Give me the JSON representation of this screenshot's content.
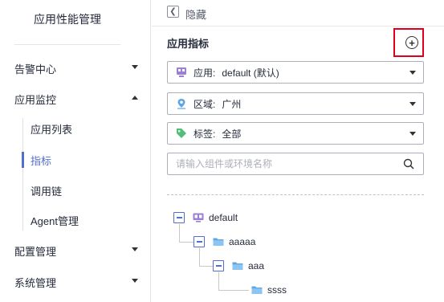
{
  "sidebar": {
    "app_title": "应用性能管理",
    "menu": [
      {
        "label": "告警中心"
      },
      {
        "label": "应用监控"
      },
      {
        "label": "配置管理"
      },
      {
        "label": "系统管理"
      }
    ],
    "sub_items": [
      {
        "label": "应用列表"
      },
      {
        "label": "指标"
      },
      {
        "label": "调用链"
      },
      {
        "label": "Agent管理"
      }
    ]
  },
  "topbar": {
    "hide_label": "隐藏"
  },
  "panel": {
    "title": "应用指标",
    "app_select": {
      "label": "应用:",
      "value": "default (默认)"
    },
    "region_select": {
      "label": "区域:",
      "value": "广州"
    },
    "tag_select": {
      "label": "标签:",
      "value": "全部"
    },
    "search": {
      "placeholder": "请输入组件或环境名称"
    }
  },
  "tree": {
    "nodes": [
      {
        "label": "default"
      },
      {
        "label": "aaaaa"
      },
      {
        "label": "aaa"
      },
      {
        "label": "ssss"
      }
    ]
  },
  "colors": {
    "accent": "#526ecc",
    "highlight_box": "#e0001b",
    "folder": "#5ca6e6",
    "app_icon": "#9b7fd6",
    "tag_icon": "#4fbf7a"
  }
}
